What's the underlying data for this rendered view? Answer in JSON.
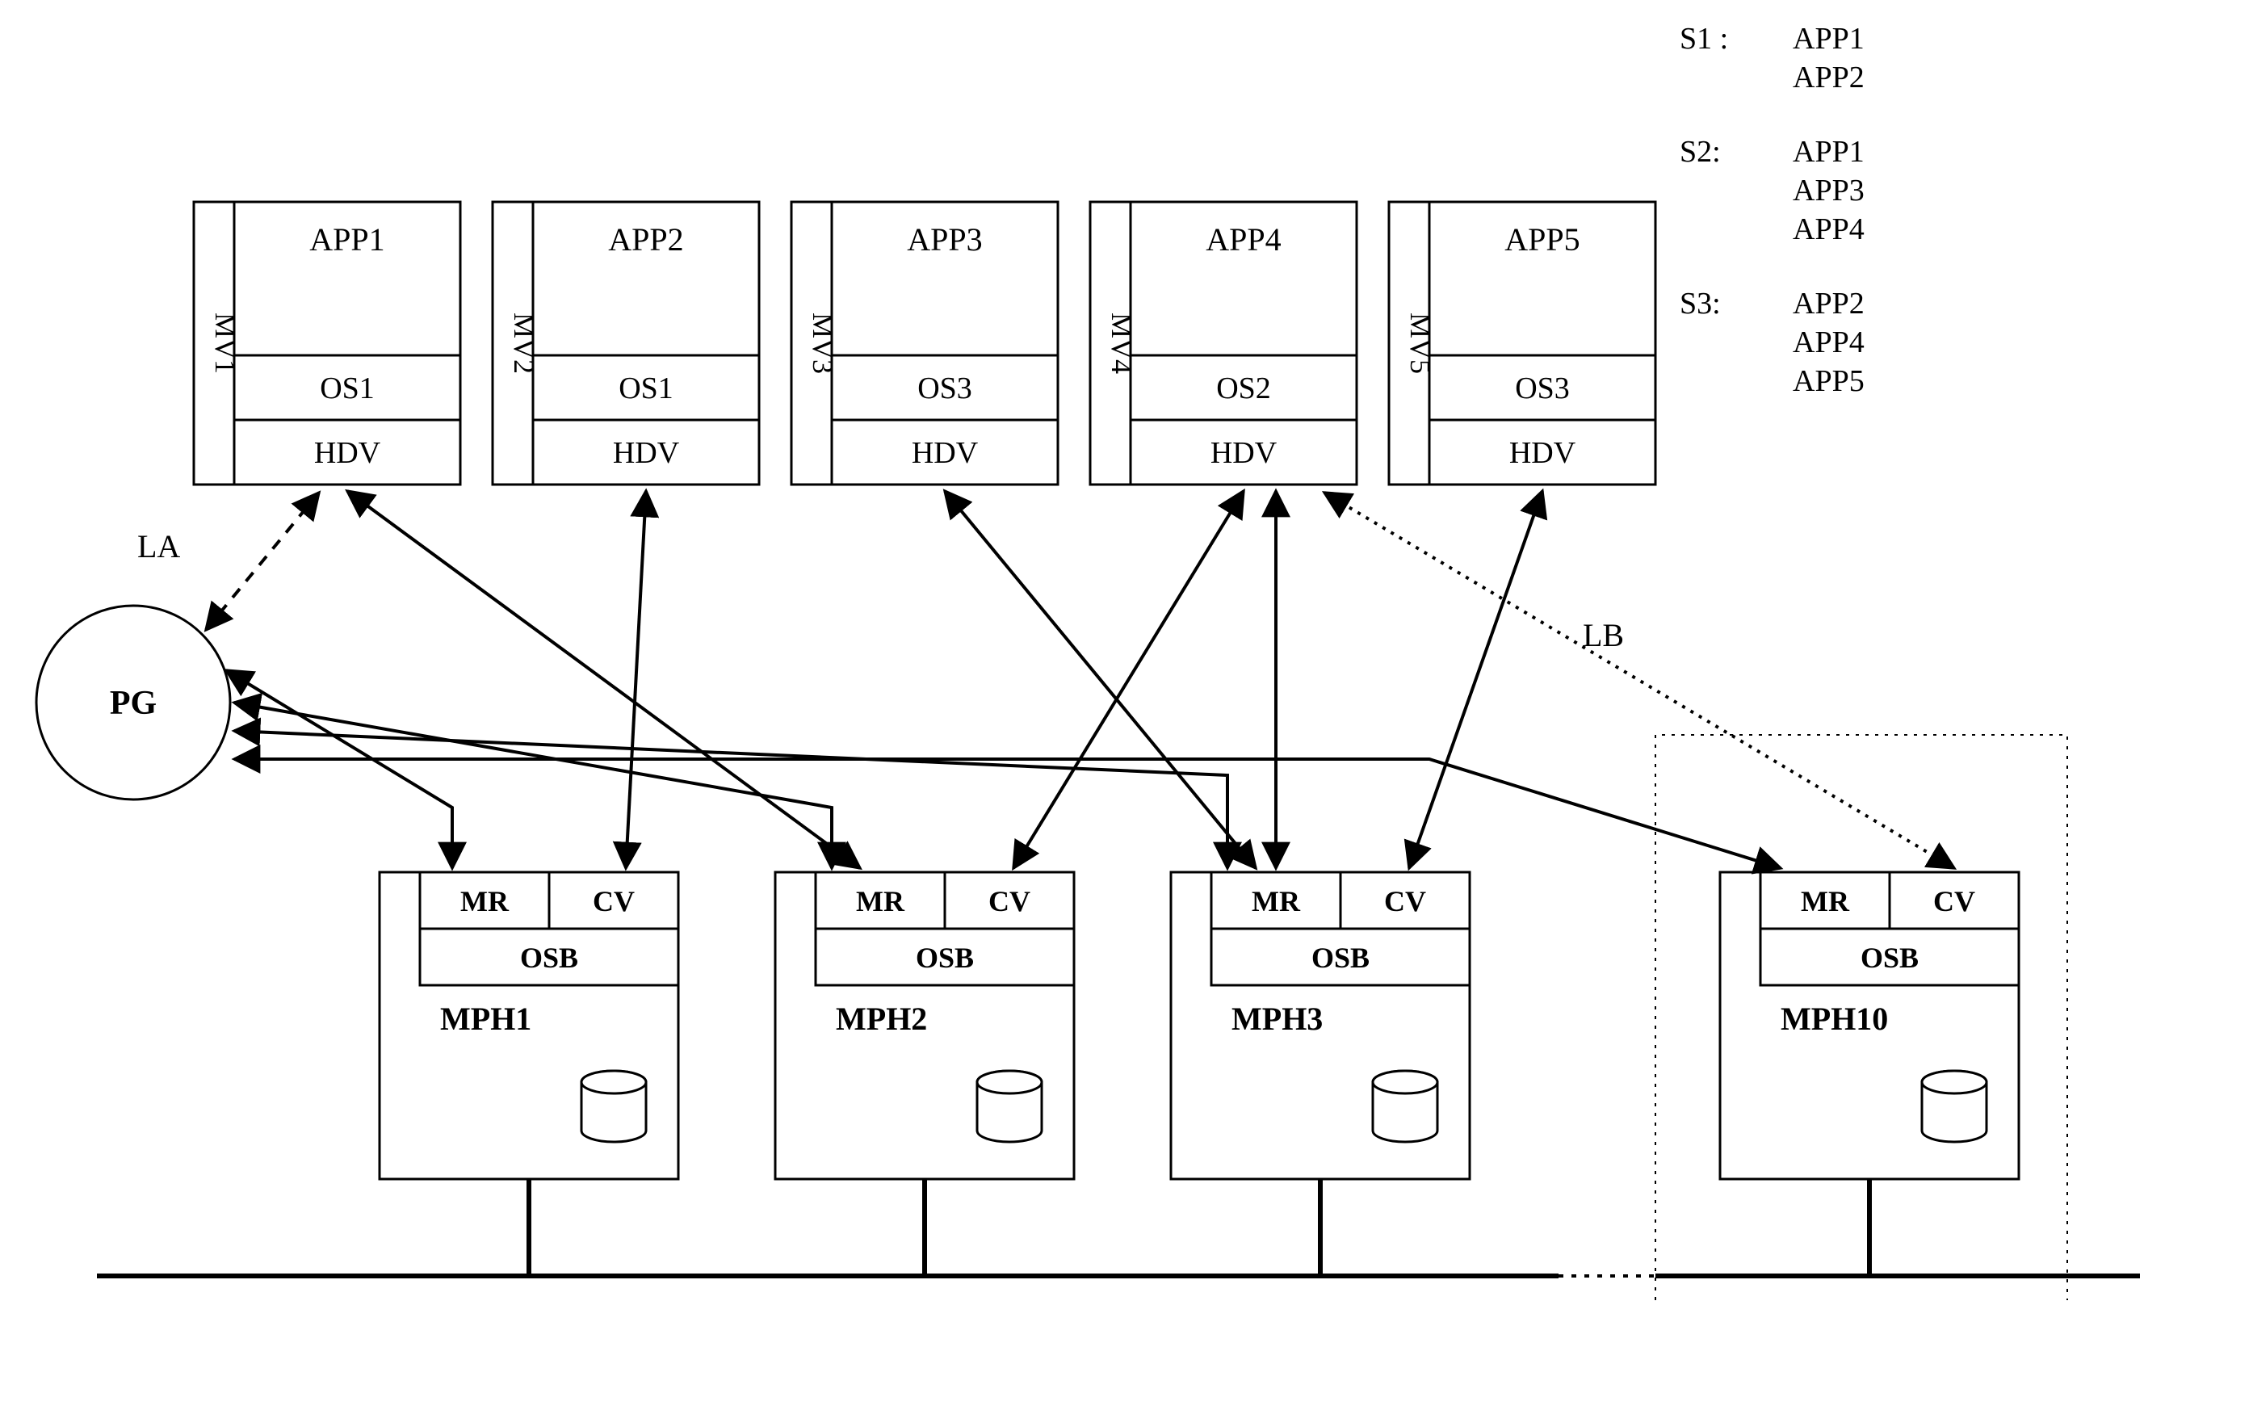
{
  "legend": {
    "s1": {
      "label": "S1 :",
      "items": [
        "APP1",
        "APP2"
      ]
    },
    "s2": {
      "label": "S2:",
      "items": [
        "APP1",
        "APP3",
        "APP4"
      ]
    },
    "s3": {
      "label": "S3:",
      "items": [
        "APP2",
        "APP4",
        "APP5"
      ]
    }
  },
  "mv": [
    {
      "mv": "MV1",
      "app": "APP1",
      "os": "OS1",
      "hdv": "HDV"
    },
    {
      "mv": "MV2",
      "app": "APP2",
      "os": "OS1",
      "hdv": "HDV"
    },
    {
      "mv": "MV3",
      "app": "APP3",
      "os": "OS3",
      "hdv": "HDV"
    },
    {
      "mv": "MV4",
      "app": "APP4",
      "os": "OS2",
      "hdv": "HDV"
    },
    {
      "mv": "MV5",
      "app": "APP5",
      "os": "OS3",
      "hdv": "HDV"
    }
  ],
  "mph": [
    {
      "mr": "MR",
      "cv": "CV",
      "osb": "OSB",
      "name": "MPH1"
    },
    {
      "mr": "MR",
      "cv": "CV",
      "osb": "OSB",
      "name": "MPH2"
    },
    {
      "mr": "MR",
      "cv": "CV",
      "osb": "OSB",
      "name": "MPH3"
    },
    {
      "mr": "MR",
      "cv": "CV",
      "osb": "OSB",
      "name": "MPH10"
    }
  ],
  "pg": "PG",
  "la": "LA",
  "lb": "LB"
}
